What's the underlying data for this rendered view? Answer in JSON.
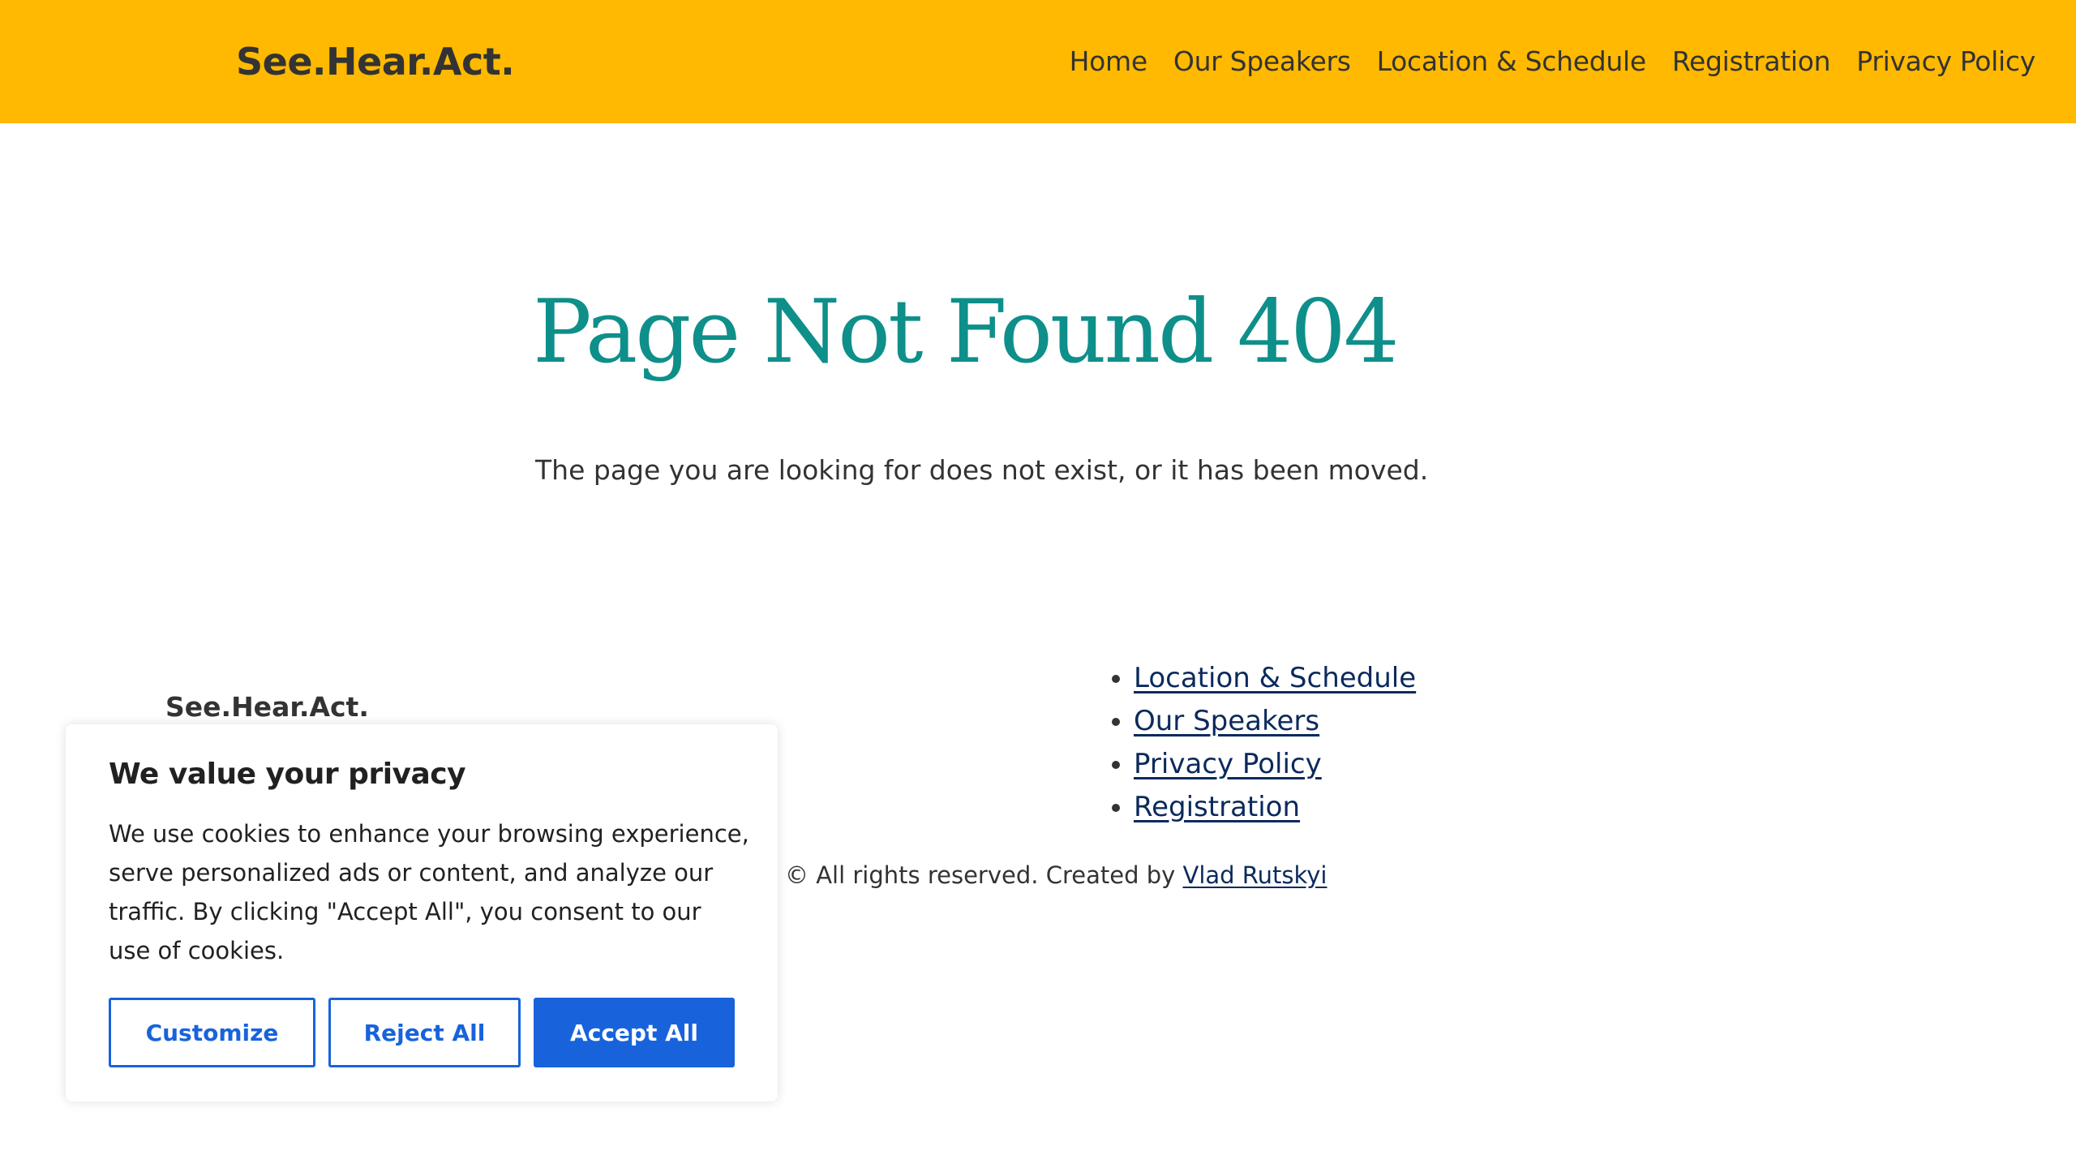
{
  "header": {
    "site_title": "See.Hear.Act.",
    "nav": [
      {
        "label": "Home"
      },
      {
        "label": "Our Speakers"
      },
      {
        "label": "Location & Schedule"
      },
      {
        "label": "Registration"
      },
      {
        "label": "Privacy Policy"
      }
    ]
  },
  "main": {
    "heading": "Page Not Found 404",
    "message": "The page you are looking for does not exist, or it has been moved."
  },
  "footer": {
    "title": "See.Hear.Act.",
    "links": [
      {
        "label": "Location & Schedule"
      },
      {
        "label": "Our Speakers"
      },
      {
        "label": "Privacy Policy"
      },
      {
        "label": "Registration"
      }
    ],
    "copyright_text": "© All rights reserved. Created by ",
    "author_link": "Vlad Rutskyi"
  },
  "cookie_banner": {
    "title": "We value your privacy",
    "text": "We use cookies to enhance your browsing experience, serve personalized ads or content, and analyze our traffic. By clicking \"Accept All\", you consent to our use of cookies.",
    "customize_label": "Customize",
    "reject_label": "Reject All",
    "accept_label": "Accept All"
  },
  "colors": {
    "header_bg": "#ffb900",
    "heading": "#0e8f8a",
    "link": "#0b2a5c",
    "button_accent": "#1863dc"
  }
}
